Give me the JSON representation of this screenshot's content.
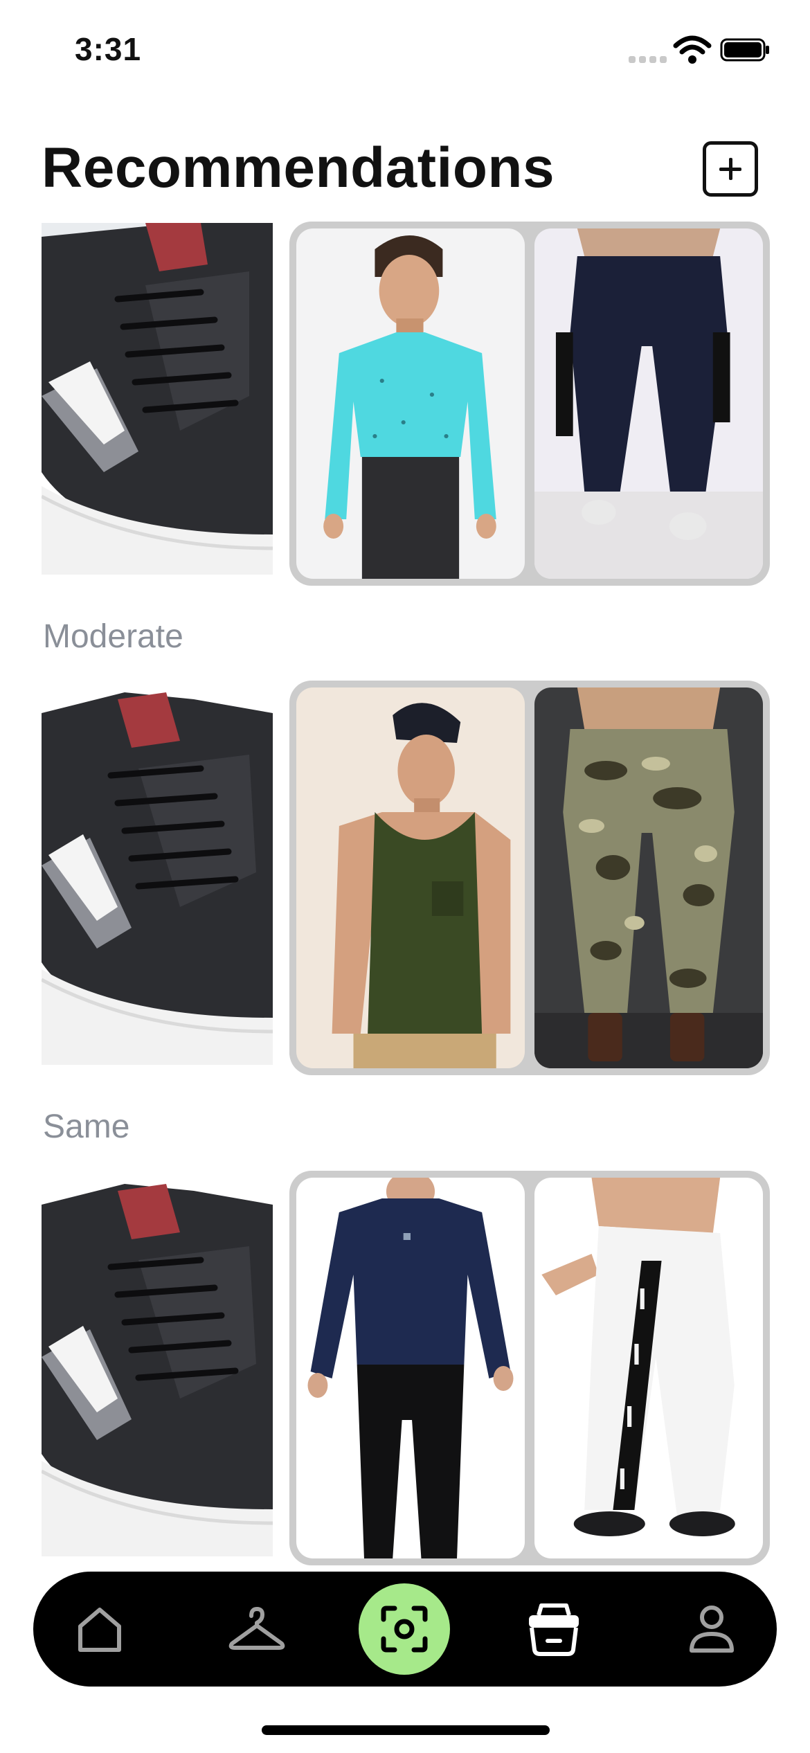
{
  "status_bar": {
    "time": "3:31"
  },
  "header": {
    "title": "Recommendations"
  },
  "sections": [
    {
      "label": "",
      "top_item": "turquoise-print-shirt",
      "bottom_item": "navy-cargo-joggers"
    },
    {
      "label": "Moderate",
      "top_item": "olive-tank-top",
      "bottom_item": "camo-cargo-pants"
    },
    {
      "label": "Same",
      "top_item": "navy-compression-top",
      "bottom_item": "white-track-pants"
    }
  ],
  "colors": {
    "accent": "#a6e98a",
    "frame": "#cccccc",
    "label_gray": "#8a8f98",
    "tab_bar": "#000000"
  },
  "tab_bar": {
    "items": [
      {
        "name": "home",
        "icon": "home-icon"
      },
      {
        "name": "wardrobe",
        "icon": "hanger-icon"
      },
      {
        "name": "scan",
        "icon": "scan-icon",
        "active": true
      },
      {
        "name": "laundry",
        "icon": "basket-icon"
      },
      {
        "name": "profile",
        "icon": "person-icon"
      }
    ]
  }
}
